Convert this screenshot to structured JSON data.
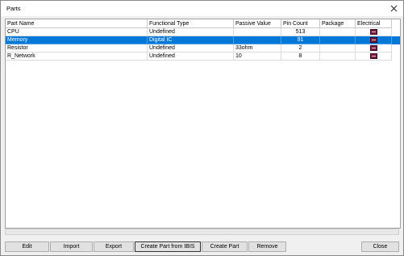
{
  "window": {
    "title": "Parts"
  },
  "table": {
    "columns": [
      "Part Name",
      "Functional Type",
      "Passive Value",
      "Pin Count",
      "Package",
      "Electrical"
    ],
    "rows": [
      {
        "name": "CPU",
        "type": "Undefined",
        "passive": "",
        "pins": "513",
        "package": "",
        "electrical_icon": "electrical-model-icon",
        "selected": false
      },
      {
        "name": "Memory",
        "type": "Digital IC",
        "passive": "",
        "pins": "91",
        "package": "",
        "electrical_icon": "electrical-model-icon",
        "selected": true
      },
      {
        "name": "Resistor",
        "type": "Undefined",
        "passive": "33ohm",
        "pins": "2",
        "package": "",
        "electrical_icon": "electrical-model-icon",
        "selected": false
      },
      {
        "name": "R_Network",
        "type": "Undefined",
        "passive": "10",
        "pins": "8",
        "package": "",
        "electrical_icon": "electrical-model-icon",
        "selected": false
      }
    ]
  },
  "buttons": {
    "edit": "Edit",
    "import": "Import",
    "export": "Export",
    "create_from_ibis": "Create Part from IBIS",
    "create_part": "Create Part",
    "remove": "Remove",
    "close": "Close"
  },
  "colors": {
    "selection": "#0078d7",
    "electrical_icon": "#7a1a3e"
  }
}
